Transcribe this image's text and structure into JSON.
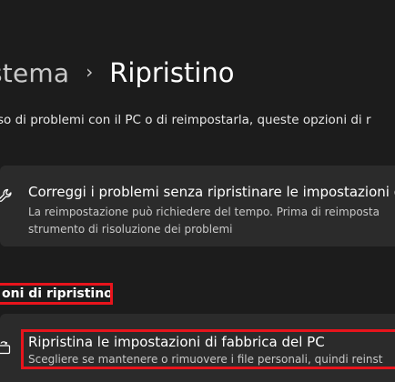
{
  "breadcrumb": {
    "parent": "stema",
    "separator": "›",
    "current": "Ripristino"
  },
  "intro": {
    "text": "so di problemi con il PC o di reimpostarla, queste opzioni di r"
  },
  "fix_card": {
    "icon": "wrench-icon",
    "title": "Correggi i problemi senza ripristinare le impostazioni di f",
    "desc_line1": "La reimpostazione può richiedere del tempo. Prima di reimposta",
    "desc_line2": "strumento di risoluzione dei problemi"
  },
  "recovery_section": {
    "header": "oni di ripristino",
    "highlight_color": "#e8141c"
  },
  "reset_card": {
    "icon": "reset-pc-icon",
    "title": "Ripristina le impostazioni di fabbrica del PC",
    "desc": "Scegliere se mantenere o rimuovere i file personali, quindi reinst"
  },
  "colors": {
    "background": "#1c1c1c",
    "card": "#2b2b2b",
    "highlight": "#e8141c"
  }
}
